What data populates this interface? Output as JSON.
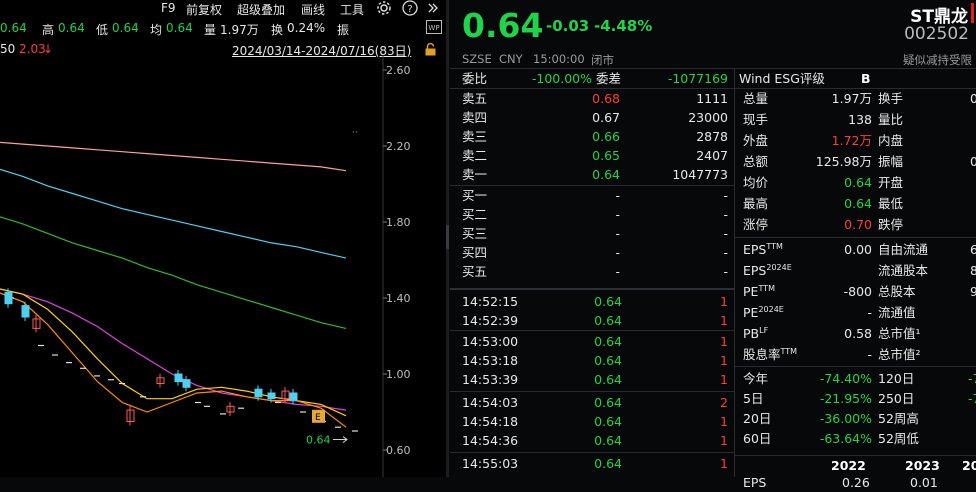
{
  "toolbar": {
    "f9": "F9",
    "adjust": "前复权",
    "overlay": "超级叠加",
    "draw": "画线",
    "tools": "工具",
    "amplitude": "振"
  },
  "quote_line": {
    "first_value": "0.64",
    "high_label": "高",
    "high_value": "0.64",
    "low_label": "低",
    "low_value": "0.64",
    "avg_label": "均",
    "avg_value": "0.64",
    "volume_label": "量",
    "volume_value": "1.97万",
    "turnover_label": "换",
    "turnover_value": "0.24%",
    "amplitude_label": "振"
  },
  "sub_line": {
    "left_value": "50",
    "red_value": "2.03",
    "red_arrow": "↓",
    "date_range": "2024/03/14-2024/07/16(83日)"
  },
  "chart_data": {
    "type": "candlestick",
    "y_ticks": [
      "2.60",
      "2.20",
      "1.80",
      "1.40",
      "1.00",
      "0.60"
    ],
    "y_range": [
      0.6,
      2.6
    ],
    "last_price_label": "0.64",
    "ma_series": [
      {
        "name": "",
        "color": "#ff9f9f",
        "values": [
          2.22,
          2.21,
          2.2,
          2.19,
          2.18,
          2.17,
          2.16,
          2.15,
          2.14,
          2.13,
          2.12,
          2.11,
          2.1,
          2.09,
          2.07
        ]
      },
      {
        "name": "",
        "color": "#4fd0f0",
        "values": [
          2.08,
          2.04,
          1.99,
          1.95,
          1.91,
          1.87,
          1.84,
          1.81,
          1.78,
          1.75,
          1.72,
          1.69,
          1.67,
          1.64,
          1.61
        ]
      },
      {
        "name": "",
        "color": "#30b830",
        "values": [
          1.83,
          1.79,
          1.74,
          1.69,
          1.65,
          1.61,
          1.56,
          1.52,
          1.47,
          1.43,
          1.39,
          1.35,
          1.31,
          1.27,
          1.24
        ]
      },
      {
        "name": "",
        "color": "#e040e0",
        "values": [
          1.45,
          1.42,
          1.38,
          1.32,
          1.25,
          1.16,
          1.08,
          1.0,
          0.94,
          0.9,
          0.88,
          0.86,
          0.84,
          0.83,
          0.81
        ]
      }
    ],
    "fast_ma": [
      {
        "name": "",
        "color": "#ffd200",
        "values": [
          1.45,
          1.42,
          1.34,
          1.22,
          1.08,
          0.95,
          0.87,
          0.87,
          0.92,
          0.93,
          0.91,
          0.88,
          0.86,
          0.84,
          0.78
        ]
      },
      {
        "name": "",
        "color": "#ff8c00",
        "values": [
          1.43,
          1.38,
          1.26,
          1.11,
          0.96,
          0.85,
          0.8,
          0.85,
          0.9,
          0.91,
          0.88,
          0.86,
          0.86,
          0.82,
          0.72
        ]
      }
    ]
  },
  "header": {
    "price": "0.64",
    "change": "-0.03",
    "change_pct": "-4.48%",
    "name": "ST鼎龙",
    "code": "002502",
    "exchange": "SZSE",
    "currency": "CNY",
    "time": "15:00:00",
    "status": "闭市",
    "note": "疑似减持受限"
  },
  "committee": {
    "ratio_label": "委比",
    "ratio_value": "-100.00%",
    "diff_label": "委差",
    "diff_value": "-1077169"
  },
  "asks": [
    {
      "label": "卖五",
      "price": "0.68",
      "vol": "1111",
      "color": "red"
    },
    {
      "label": "卖四",
      "price": "0.67",
      "vol": "23000",
      "color": "white"
    },
    {
      "label": "卖三",
      "price": "0.66",
      "vol": "2878",
      "color": "green"
    },
    {
      "label": "卖二",
      "price": "0.65",
      "vol": "2407",
      "color": "green"
    },
    {
      "label": "卖一",
      "price": "0.64",
      "vol": "1047773",
      "color": "green"
    }
  ],
  "bids": [
    {
      "label": "买一",
      "price": "-",
      "vol": "-"
    },
    {
      "label": "买二",
      "price": "-",
      "vol": "-"
    },
    {
      "label": "买三",
      "price": "-",
      "vol": "-"
    },
    {
      "label": "买四",
      "price": "-",
      "vol": "-"
    },
    {
      "label": "买五",
      "price": "-",
      "vol": "-"
    }
  ],
  "ticks": [
    {
      "time": "14:52:15",
      "price": "0.64",
      "vol": "1"
    },
    {
      "time": "14:52:39",
      "price": "0.64",
      "vol": "1"
    },
    {
      "time": "14:53:00",
      "price": "0.64",
      "vol": "1"
    },
    {
      "time": "14:53:18",
      "price": "0.64",
      "vol": "1"
    },
    {
      "time": "14:53:39",
      "price": "0.64",
      "vol": "1"
    },
    {
      "time": "14:54:03",
      "price": "0.64",
      "vol": "2"
    },
    {
      "time": "14:54:18",
      "price": "0.64",
      "vol": "1"
    },
    {
      "time": "14:54:36",
      "price": "0.64",
      "vol": "1"
    },
    {
      "time": "14:55:03",
      "price": "0.64",
      "vol": "1"
    }
  ],
  "esg": {
    "label": "Wind ESG评级",
    "value": "B"
  },
  "stats": [
    {
      "l1": "总量",
      "v1": "1.97万",
      "c1": "white",
      "l2": "换手",
      "v2": "0"
    },
    {
      "l1": "现手",
      "v1": "138",
      "c1": "white",
      "l2": "量比",
      "v2": ""
    },
    {
      "l1": "外盘",
      "v1": "1.72万",
      "c1": "red",
      "l2": "内盘",
      "v2": ""
    },
    {
      "l1": "总额",
      "v1": "125.98万",
      "c1": "white",
      "l2": "振幅",
      "v2": "0"
    },
    {
      "l1": "均价",
      "v1": "0.64",
      "c1": "green",
      "l2": "开盘",
      "v2": ""
    },
    {
      "l1": "最高",
      "v1": "0.64",
      "c1": "green",
      "l2": "最低",
      "v2": ""
    },
    {
      "l1": "涨停",
      "v1": "0.70",
      "c1": "red",
      "l2": "跌停",
      "v2": ""
    }
  ],
  "valuation": [
    {
      "l1": "EPS",
      "sup": "TTM",
      "v1": "0.00",
      "l2": "自由流通",
      "v2": "6"
    },
    {
      "l1": "EPS",
      "sup": "2024E",
      "v1": "",
      "l2": "流通股本",
      "v2": "8"
    },
    {
      "l1": "PE",
      "sup": "TTM",
      "v1": "-800",
      "l2": "总股本",
      "v2": "9"
    },
    {
      "l1": "PE",
      "sup": "2024E",
      "v1": "-",
      "l2": "流通值",
      "v2": ""
    },
    {
      "l1": "PB",
      "sup": "LF",
      "v1": "0.58",
      "l2": "总市值¹",
      "v2": ""
    },
    {
      "l1": "股息率",
      "sup": "TTM",
      "v1": "-",
      "l2": "总市值²",
      "v2": ""
    }
  ],
  "performance": [
    {
      "l1": "今年",
      "v1": "-74.40%",
      "l2": "120日",
      "v2": "-7"
    },
    {
      "l1": "5日",
      "v1": "-21.95%",
      "l2": "250日",
      "v2": "-7"
    },
    {
      "l1": "20日",
      "v1": "-36.00%",
      "l2": "52周高",
      "v2": ""
    },
    {
      "l1": "60日",
      "v1": "-63.64%",
      "l2": "52周低",
      "v2": ""
    }
  ],
  "years": {
    "y1": "2022",
    "y2": "2023",
    "y3": "20"
  },
  "eps_partial": {
    "label": "EPS",
    "v1": "0.26",
    "v2": "0.01"
  },
  "colors": {
    "up": "#ff3b3b",
    "down": "#1fd34a",
    "bg": "#07080a",
    "text": "#d9d9d9"
  }
}
